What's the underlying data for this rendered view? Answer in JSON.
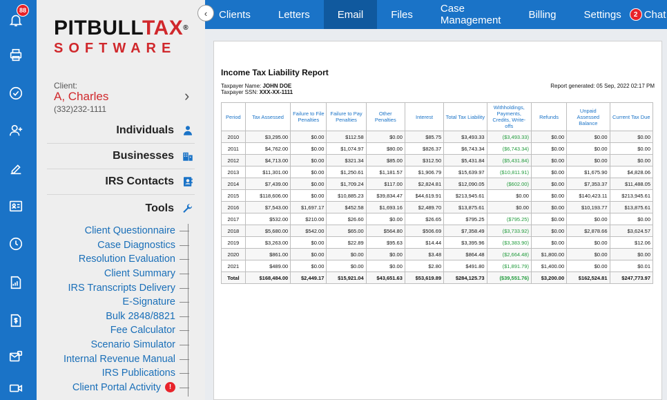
{
  "rail": {
    "notification_count": "88"
  },
  "logo": {
    "top_black": "PITBULL",
    "top_red": "TAX",
    "reg": "®",
    "bottom": "SOFTWARE"
  },
  "client": {
    "label": "Client:",
    "name": "A, Charles",
    "phone": "(332)232-1111"
  },
  "sections": [
    {
      "label": "Individuals"
    },
    {
      "label": "Businesses"
    },
    {
      "label": "IRS Contacts"
    },
    {
      "label": "Tools"
    }
  ],
  "tools": [
    "Client Questionnaire",
    "Case Diagnostics",
    "Resolution Evaluation",
    "Client Summary",
    "IRS Transcripts Delivery",
    "E-Signature",
    "Bulk 2848/8821",
    "Fee Calculator",
    "Scenario Simulator",
    "Internal Revenue Manual",
    "IRS Publications",
    "Client Portal Activity"
  ],
  "portal_badge": "!",
  "nav": {
    "items": [
      "Clients",
      "Letters",
      "Email",
      "Files",
      "Case Management",
      "Billing",
      "Settings"
    ],
    "active": "Email",
    "chat_count": "2",
    "chat_label": "Chat"
  },
  "report": {
    "title": "Income Tax Liability Report",
    "taxpayer_name_label": "Taxpayer Name:",
    "taxpayer_name": "JOHN DOE",
    "taxpayer_ssn_label": "Taxpayer SSN:",
    "taxpayer_ssn": "XXX-XX-1111",
    "generated": "Report generated: 05 Sep, 2022 02:17 PM",
    "columns": [
      "Period",
      "Tax Assessed",
      "Failure to File Penalties",
      "Failure to Pay Penalties",
      "Other Penalties",
      "Interest",
      "Total Tax Liability",
      "Withholdings, Payments, Credits, Write-offs",
      "Refunds",
      "Unpaid Assessed Balance",
      "Current Tax Due"
    ],
    "rows": [
      [
        "2010",
        "$3,295.00",
        "$0.00",
        "$112.58",
        "$0.00",
        "$85.75",
        "$3,493.33",
        "($3,493.33)",
        "$0.00",
        "$0.00",
        "$0.00"
      ],
      [
        "2011",
        "$4,762.00",
        "$0.00",
        "$1,074.97",
        "$80.00",
        "$826.37",
        "$6,743.34",
        "($6,743.34)",
        "$0.00",
        "$0.00",
        "$0.00"
      ],
      [
        "2012",
        "$4,713.00",
        "$0.00",
        "$321.34",
        "$85.00",
        "$312.50",
        "$5,431.84",
        "($5,431.84)",
        "$0.00",
        "$0.00",
        "$0.00"
      ],
      [
        "2013",
        "$11,301.00",
        "$0.00",
        "$1,250.61",
        "$1,181.57",
        "$1,906.79",
        "$15,639.97",
        "($10,811.91)",
        "$0.00",
        "$1,675.90",
        "$4,828.06"
      ],
      [
        "2014",
        "$7,439.00",
        "$0.00",
        "$1,709.24",
        "$117.00",
        "$2,824.81",
        "$12,090.05",
        "($602.00)",
        "$0.00",
        "$7,353.37",
        "$11,488.05"
      ],
      [
        "2015",
        "$118,606.00",
        "$0.00",
        "$10,885.23",
        "$39,834.47",
        "$44,619.91",
        "$213,945.61",
        "$0.00",
        "$0.00",
        "$140,423.11",
        "$213,945.61"
      ],
      [
        "2016",
        "$7,543.00",
        "$1,697.17",
        "$452.58",
        "$1,693.16",
        "$2,489.70",
        "$13,875.61",
        "$0.00",
        "$0.00",
        "$10,193.77",
        "$13,875.61"
      ],
      [
        "2017",
        "$532.00",
        "$210.00",
        "$26.60",
        "$0.00",
        "$26.65",
        "$795.25",
        "($795.25)",
        "$0.00",
        "$0.00",
        "$0.00"
      ],
      [
        "2018",
        "$5,680.00",
        "$542.00",
        "$65.00",
        "$564.80",
        "$506.69",
        "$7,358.49",
        "($3,733.92)",
        "$0.00",
        "$2,878.66",
        "$3,624.57"
      ],
      [
        "2019",
        "$3,263.00",
        "$0.00",
        "$22.89",
        "$95.63",
        "$14.44",
        "$3,395.96",
        "($3,383.90)",
        "$0.00",
        "$0.00",
        "$12.06"
      ],
      [
        "2020",
        "$861.00",
        "$0.00",
        "$0.00",
        "$0.00",
        "$3.48",
        "$864.48",
        "($2,664.48)",
        "$1,800.00",
        "$0.00",
        "$0.00"
      ],
      [
        "2021",
        "$489.00",
        "$0.00",
        "$0.00",
        "$0.00",
        "$2.80",
        "$491.80",
        "($1,891.79)",
        "$1,400.00",
        "$0.00",
        "$0.01"
      ]
    ],
    "total": [
      "Total",
      "$168,484.00",
      "$2,449.17",
      "$15,921.04",
      "$43,651.63",
      "$53,619.89",
      "$284,125.73",
      "($39,551.76)",
      "$3,200.00",
      "$162,524.81",
      "$247,773.97"
    ],
    "colors": {
      "header_text": "#1a73c7",
      "credit_text": "#1f9a3a"
    }
  }
}
